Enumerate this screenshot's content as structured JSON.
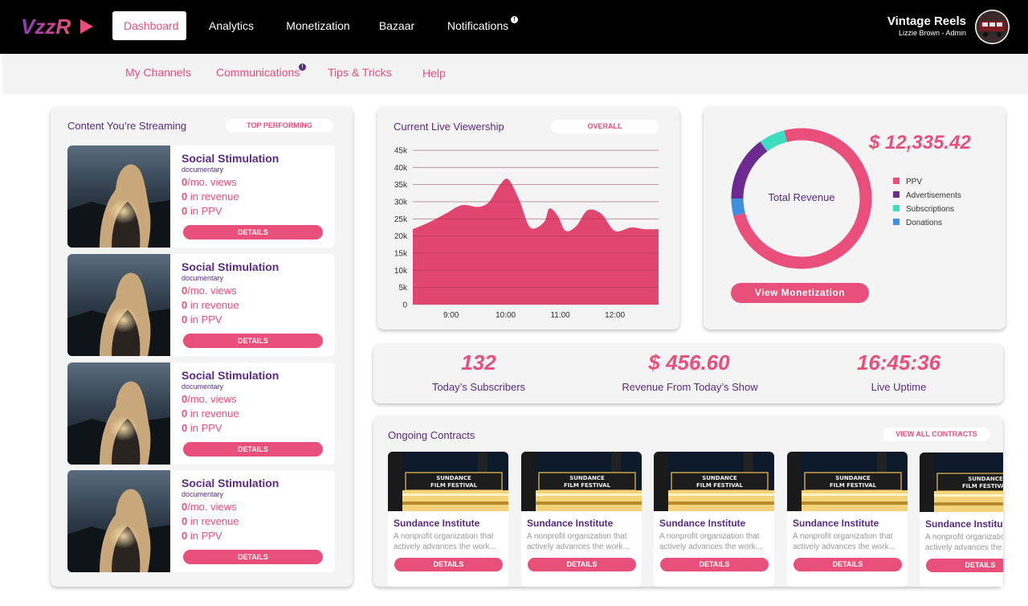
{
  "header": {
    "nav": [
      {
        "label": "Dashboard"
      },
      {
        "label": "Analytics"
      },
      {
        "label": "Monetization"
      },
      {
        "label": "Bazaar"
      },
      {
        "label": "Notifications"
      }
    ],
    "notification_badge": "!",
    "user_name": "Vintage Reels",
    "user_role": "Lizzie Brown - Admin"
  },
  "subnav": [
    {
      "label": "My Channels"
    },
    {
      "label": "Communications"
    },
    {
      "label": "Tips & Tricks"
    },
    {
      "label": "Help"
    }
  ],
  "subnav_badge": "!",
  "streaming": {
    "title": "Content You’re Streaming",
    "tag": "TOP PERFORMING",
    "items": [
      {
        "title": "Social Stimulation",
        "type": "documentary",
        "views": "0",
        "views_label": "/mo. views",
        "revenue": "0",
        "revenue_label": " in revenue",
        "ppv": "0",
        "ppv_label": " in PPV",
        "button": "DETAILS"
      },
      {
        "title": "Social Stimulation",
        "type": "documentary",
        "views": "0",
        "views_label": "/mo. views",
        "revenue": "0",
        "revenue_label": " in revenue",
        "ppv": "0",
        "ppv_label": " in PPV",
        "button": "DETAILS"
      },
      {
        "title": "Social Stimulation",
        "type": "documentary",
        "views": "0",
        "views_label": "/mo. views",
        "revenue": "0",
        "revenue_label": " in revenue",
        "ppv": "0",
        "ppv_label": " in PPV",
        "button": "DETAILS"
      },
      {
        "title": "Social Stimulation",
        "type": "documentary",
        "views": "0",
        "views_label": "/mo. views",
        "revenue": "0",
        "revenue_label": " in revenue",
        "ppv": "0",
        "ppv_label": " in PPV",
        "button": "DETAILS"
      }
    ]
  },
  "viewership": {
    "title": "Current Live Viewership",
    "tag": "OVERALL"
  },
  "chart_data": {
    "type": "area",
    "title": "Current Live Viewership",
    "x_ticks": [
      "9:00",
      "10:00",
      "11:00",
      "12:00"
    ],
    "y_ticks": [
      "0",
      "5k",
      "10k",
      "15k",
      "20k",
      "25k",
      "30k",
      "35k",
      "40k",
      "45k"
    ],
    "ylim": [
      0,
      45000
    ],
    "x": [
      8.3,
      8.6,
      8.9,
      9.2,
      9.5,
      9.7,
      9.9,
      10.05,
      10.25,
      10.45,
      10.7,
      10.8,
      10.95,
      11.1,
      11.3,
      11.5,
      11.75,
      12.0,
      12.3,
      12.55,
      12.8
    ],
    "values": [
      22000,
      24000,
      26500,
      29000,
      28500,
      30000,
      35000,
      36500,
      30500,
      22500,
      24000,
      28000,
      26000,
      21500,
      23000,
      27500,
      26500,
      21500,
      22500,
      22000,
      22000
    ],
    "color": "#e0466f",
    "grid": true
  },
  "revenue": {
    "amount": "$ 12,335.42",
    "center_label": "Total Revenue",
    "button": "View Monetization",
    "legend": [
      {
        "label": "PPV",
        "color": "#ea4f7c",
        "value": 0.75
      },
      {
        "label": "Advertisements",
        "color": "#6d2b91",
        "value": 0.15
      },
      {
        "label": "Subscriptions",
        "color": "#3ddbc0",
        "value": 0.06
      },
      {
        "label": "Donations",
        "color": "#3d8fe0",
        "value": 0.04
      }
    ]
  },
  "stats": [
    {
      "value": "132",
      "label": "Today’s Subscribers"
    },
    {
      "value": "$ 456.60",
      "label": "Revenue From Today’s Show"
    },
    {
      "value": "16:45:36",
      "label": "Live Uptime"
    }
  ],
  "contracts": {
    "title": "Ongoing Contracts",
    "tag": "VIEW ALL CONTRACTS",
    "marquee": [
      "SUNDANCE",
      "FILM FESTIVAL"
    ],
    "items": [
      {
        "title": "Sundance Institute",
        "desc": "A nonprofit organization that actively advances the work...",
        "button": "DETAILS"
      },
      {
        "title": "Sundance Institute",
        "desc": "A nonprofit organization that actively advances the work...",
        "button": "DETAILS"
      },
      {
        "title": "Sundance Institute",
        "desc": "A nonprofit organization that actively advances the work...",
        "button": "DETAILS"
      },
      {
        "title": "Sundance Institute",
        "desc": "A nonprofit organization that actively advances the work...",
        "button": "DETAILS"
      },
      {
        "title": "Sundance Institute",
        "desc": "A nonprofit organization that actively advances the work...",
        "button": "DETAILS"
      }
    ]
  },
  "colors": {
    "accent": "#e84f7a",
    "brand": "#5b2a86"
  },
  "logo_text": "VzzR"
}
